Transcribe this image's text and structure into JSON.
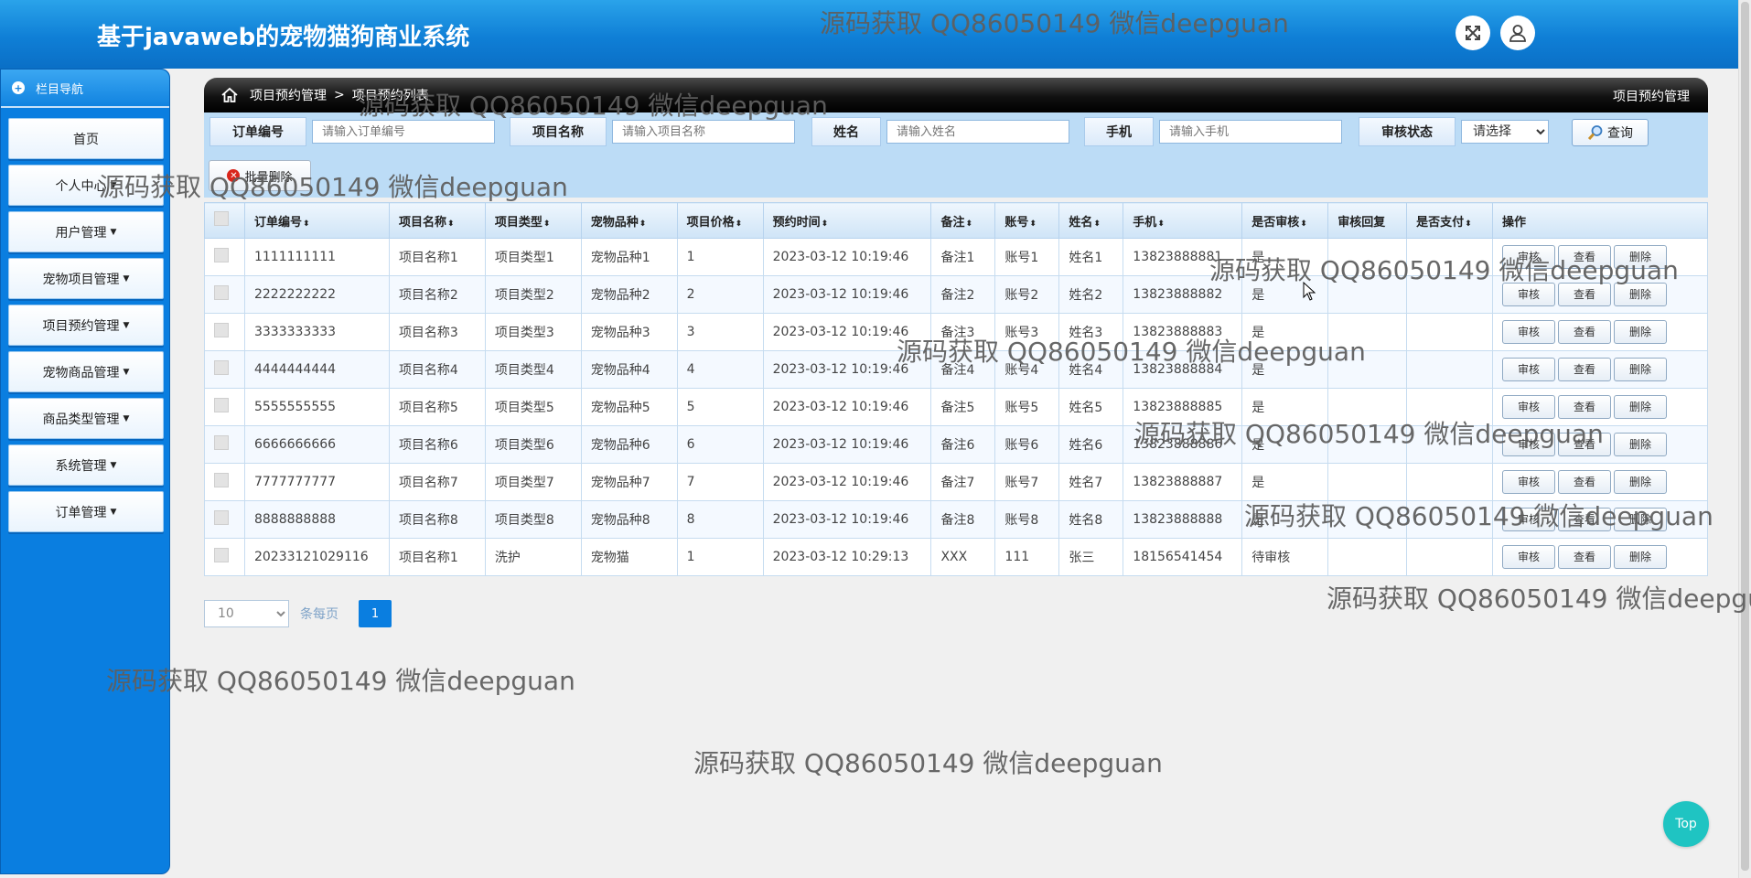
{
  "app": {
    "title": "基于javaweb的宠物猫狗商业系统"
  },
  "header": {
    "fullscreen_icon": "expand-icon",
    "user_icon": "user-icon"
  },
  "sidebar": {
    "heading": "栏目导航",
    "items": [
      {
        "label": "首页",
        "caret": false
      },
      {
        "label": "个人中心",
        "caret": true
      },
      {
        "label": "用户管理",
        "caret": true
      },
      {
        "label": "宠物项目管理",
        "caret": true
      },
      {
        "label": "项目预约管理",
        "caret": true
      },
      {
        "label": "宠物商品管理",
        "caret": true
      },
      {
        "label": "商品类型管理",
        "caret": true
      },
      {
        "label": "系统管理",
        "caret": true
      },
      {
        "label": "订单管理",
        "caret": true
      }
    ]
  },
  "breadcrumb": {
    "parent": "项目预约管理",
    "separator": ">",
    "current": "项目预约列表",
    "right_title": "项目预约管理"
  },
  "search": {
    "order_no": {
      "label": "订单编号",
      "placeholder": "请输入订单编号"
    },
    "project_name": {
      "label": "项目名称",
      "placeholder": "请输入项目名称"
    },
    "name": {
      "label": "姓名",
      "placeholder": "请输入姓名"
    },
    "phone": {
      "label": "手机",
      "placeholder": "请输入手机"
    },
    "status": {
      "label": "审核状态",
      "selected": "请选择"
    },
    "query_label": "查询",
    "batch_delete_label": "批量删除"
  },
  "table": {
    "headers": [
      "订单编号",
      "项目名称",
      "项目类型",
      "宠物品种",
      "项目价格",
      "预约时间",
      "备注",
      "账号",
      "姓名",
      "手机",
      "是否审核",
      "审核回复",
      "是否支付",
      "操作"
    ],
    "sortable": [
      true,
      true,
      true,
      true,
      true,
      true,
      true,
      true,
      true,
      true,
      true,
      false,
      true,
      false
    ],
    "rows": [
      [
        "1111111111",
        "项目名称1",
        "项目类型1",
        "宠物品种1",
        "1",
        "2023-03-12 10:19:46",
        "备注1",
        "账号1",
        "姓名1",
        "13823888881",
        "是",
        "",
        ""
      ],
      [
        "2222222222",
        "项目名称2",
        "项目类型2",
        "宠物品种2",
        "2",
        "2023-03-12 10:19:46",
        "备注2",
        "账号2",
        "姓名2",
        "13823888882",
        "是",
        "",
        ""
      ],
      [
        "3333333333",
        "项目名称3",
        "项目类型3",
        "宠物品种3",
        "3",
        "2023-03-12 10:19:46",
        "备注3",
        "账号3",
        "姓名3",
        "13823888883",
        "是",
        "",
        ""
      ],
      [
        "4444444444",
        "项目名称4",
        "项目类型4",
        "宠物品种4",
        "4",
        "2023-03-12 10:19:46",
        "备注4",
        "账号4",
        "姓名4",
        "13823888884",
        "是",
        "",
        ""
      ],
      [
        "5555555555",
        "项目名称5",
        "项目类型5",
        "宠物品种5",
        "5",
        "2023-03-12 10:19:46",
        "备注5",
        "账号5",
        "姓名5",
        "13823888885",
        "是",
        "",
        ""
      ],
      [
        "6666666666",
        "项目名称6",
        "项目类型6",
        "宠物品种6",
        "6",
        "2023-03-12 10:19:46",
        "备注6",
        "账号6",
        "姓名6",
        "13823888886",
        "是",
        "",
        ""
      ],
      [
        "7777777777",
        "项目名称7",
        "项目类型7",
        "宠物品种7",
        "7",
        "2023-03-12 10:19:46",
        "备注7",
        "账号7",
        "姓名7",
        "13823888887",
        "是",
        "",
        ""
      ],
      [
        "8888888888",
        "项目名称8",
        "项目类型8",
        "宠物品种8",
        "8",
        "2023-03-12 10:19:46",
        "备注8",
        "账号8",
        "姓名8",
        "13823888888",
        "是",
        "",
        ""
      ],
      [
        "20233121029116",
        "项目名称1",
        "洗护",
        "宠物猫",
        "1",
        "2023-03-12 10:29:13",
        "XXX",
        "111",
        "张三",
        "18156541454",
        "待审核",
        "",
        ""
      ]
    ],
    "actions": [
      "审核",
      "查看",
      "删除"
    ]
  },
  "pagination": {
    "page_size": "10",
    "per_page_label": "条每页",
    "current_page": "1"
  },
  "top_button": "Top",
  "watermark": "源码获取 QQ86050149 微信deepguan",
  "colors": {
    "primary": "#0a7ee0",
    "header": "#1584dc",
    "top_button": "#1fc4c2"
  }
}
